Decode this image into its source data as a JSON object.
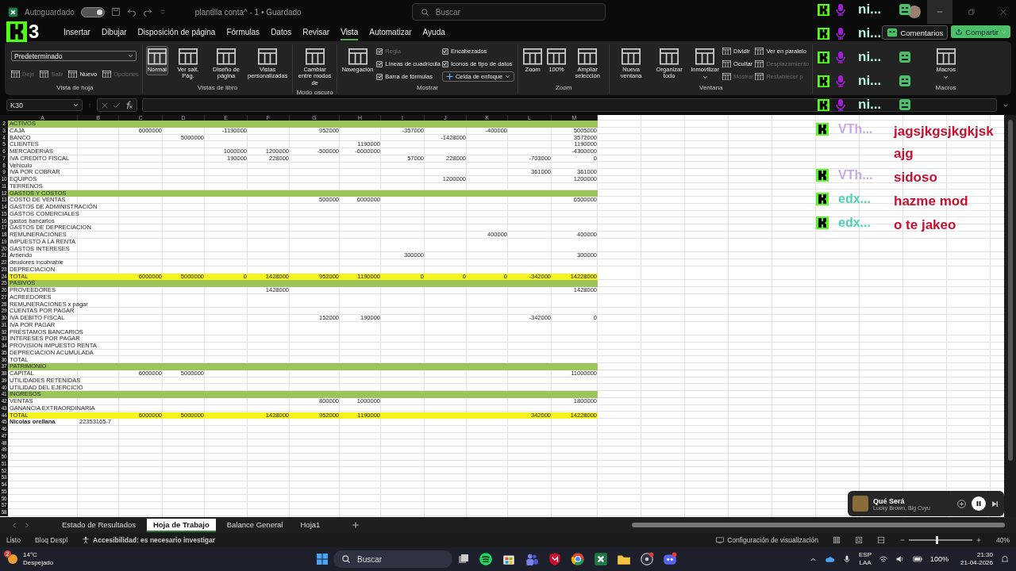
{
  "titlebar": {
    "autosave_label": "Autoguardado",
    "autosave_on": true,
    "title": "plantilla conta^ - 1 • Guardado",
    "search_placeholder": "Buscar"
  },
  "stream_badge": "3",
  "menu": [
    {
      "label": "Insertar",
      "selected": false
    },
    {
      "label": "Dibujar",
      "selected": false
    },
    {
      "label": "Disposición de página",
      "selected": false
    },
    {
      "label": "Fórmulas",
      "selected": false
    },
    {
      "label": "Datos",
      "selected": false
    },
    {
      "label": "Revisar",
      "selected": false
    },
    {
      "label": "Vista",
      "selected": true
    },
    {
      "label": "Automatizar",
      "selected": false
    },
    {
      "label": "Ayuda",
      "selected": false
    }
  ],
  "comments_button": "Comentarios",
  "share_button": "Compartir",
  "ribbon": [
    {
      "kind": "stacked",
      "label": "Vista de hoja",
      "items": [
        {
          "kind": "select",
          "label": "Predeterminado"
        },
        {
          "kind": "small",
          "label": "Deje",
          "disabled": true
        },
        {
          "kind": "small",
          "label": "Salir",
          "disabled": true
        },
        {
          "kind": "small",
          "label": "Nuevo",
          "disabled": false
        },
        {
          "kind": "small",
          "label": "Opciones",
          "disabled": true
        }
      ]
    },
    {
      "kind": "columns",
      "label": "Vistas de libro",
      "columns": [
        [
          {
            "kind": "large",
            "label": "Normal",
            "selected": true
          }
        ],
        [
          {
            "kind": "large",
            "label": "Ver salt. Pág.",
            "selected": false
          }
        ],
        [
          {
            "kind": "large",
            "label": "Diseño de página",
            "selected": false
          }
        ],
        [
          {
            "kind": "large",
            "label": "Vistas personalizadas",
            "selected": false
          }
        ]
      ]
    },
    {
      "kind": "columns",
      "label": "Modo oscuro",
      "columns": [
        [
          {
            "kind": "large",
            "label": "Cambiar entre modos de"
          }
        ]
      ]
    },
    {
      "kind": "columns",
      "label": "Mostrar",
      "columns": [
        [
          {
            "kind": "large",
            "label": "Navegación"
          }
        ],
        [
          {
            "kind": "check",
            "label": "Regla",
            "checked": true,
            "disabled": true
          },
          {
            "kind": "check",
            "label": "Líneas de cuadrícula",
            "checked": true,
            "disabled": false
          },
          {
            "kind": "check",
            "label": "Barra de fórmulas",
            "checked": true,
            "disabled": false
          }
        ],
        [
          {
            "kind": "check",
            "label": "Encabezados",
            "checked": true,
            "disabled": false
          },
          {
            "kind": "check",
            "label": "Iconos de tipo de datos",
            "checked": true,
            "disabled": false
          },
          {
            "kind": "dropdown",
            "label": "Celda de enfoque"
          }
        ]
      ]
    },
    {
      "kind": "columns",
      "label": "Zoom",
      "columns": [
        [
          {
            "kind": "large",
            "label": "Zoom"
          }
        ],
        [
          {
            "kind": "large",
            "label": "100%"
          }
        ],
        [
          {
            "kind": "large",
            "label": "Ampliar selección"
          }
        ]
      ]
    },
    {
      "kind": "columns",
      "label": "Ventana",
      "columns": [
        [
          {
            "kind": "large",
            "label": "Nueva ventana"
          }
        ],
        [
          {
            "kind": "large",
            "label": "Organizar todo"
          }
        ],
        [
          {
            "kind": "large",
            "label": "Inmovilizar",
            "menu": true
          }
        ],
        [
          {
            "kind": "small",
            "label": "Dividir",
            "disabled": false
          },
          {
            "kind": "small",
            "label": "Ocultar",
            "disabled": false
          },
          {
            "kind": "small",
            "label": "Mostrar",
            "disabled": true
          }
        ],
        [
          {
            "kind": "small",
            "label": "Ver en paralelo",
            "disabled": false
          },
          {
            "kind": "small",
            "label": "Desplazamiento",
            "disabled": true
          },
          {
            "kind": "small",
            "label": "Restablecer p",
            "disabled": true
          }
        ]
      ]
    },
    {
      "kind": "columns",
      "label": "Macros",
      "columns": [
        [
          {
            "kind": "large",
            "label": "Macros",
            "menu": true
          }
        ]
      ]
    }
  ],
  "formula_bar": {
    "name_box": "K30"
  },
  "sheet": {
    "columns": [
      "A",
      "B",
      "C",
      "D",
      "E",
      "F",
      "G",
      "H",
      "I",
      "J",
      "K",
      "L",
      "M"
    ],
    "rows": [
      {
        "num": "2",
        "kind": "section",
        "label": "ACTIVOS"
      },
      {
        "num": "3",
        "kind": "data",
        "label": "CAJA",
        "values": {
          "c": "6000000",
          "e": "-1190000",
          "g": "952000",
          "i": "-357000",
          "k": "-400000",
          "m": "5005000"
        }
      },
      {
        "num": "4",
        "kind": "data",
        "label": "BANCO",
        "values": {
          "d": "5000000",
          "j": "-1428000",
          "m": "3572000"
        }
      },
      {
        "num": "5",
        "kind": "data",
        "label": "CLIENTES",
        "values": {
          "h": "1190000",
          "m": "1190000"
        }
      },
      {
        "num": "6",
        "kind": "data",
        "label": "MERCADERIAS",
        "values": {
          "e": "1000000",
          "f": "1200000",
          "g": "-500000",
          "h": "-6000000",
          "m": "-4300000"
        }
      },
      {
        "num": "7",
        "kind": "data",
        "label": "IVA CREDITO FISCAL",
        "values": {
          "e": "190000",
          "f": "228000",
          "i": "57000",
          "j": "228000",
          "l": "-703000",
          "m": "0"
        }
      },
      {
        "num": "8",
        "kind": "data",
        "label": "Vehiculo",
        "values": {}
      },
      {
        "num": "9",
        "kind": "data",
        "label": "IVA POR COBRAR",
        "values": {
          "l": "361000",
          "m": "361000"
        }
      },
      {
        "num": "10",
        "kind": "data",
        "label": "EQUIPOS",
        "values": {
          "j": "1200000",
          "m": "1200000"
        }
      },
      {
        "num": "11",
        "kind": "data",
        "label": "TERRENOS",
        "values": {}
      },
      {
        "num": "12",
        "kind": "section",
        "label": "GASTOS Y COSTOS"
      },
      {
        "num": "13",
        "kind": "data",
        "label": "COSTO DE VENTAS",
        "values": {
          "g": "500000",
          "h": "6000000",
          "m": "6500000"
        }
      },
      {
        "num": "14",
        "kind": "data",
        "label": "GASTOS DE ADMINISTRACIÓN",
        "values": {}
      },
      {
        "num": "15",
        "kind": "data",
        "label": "GASTOS COMERCIALES",
        "values": {}
      },
      {
        "num": "16",
        "kind": "data",
        "label": "gastos bancarios",
        "values": {}
      },
      {
        "num": "17",
        "kind": "data",
        "label": " GASTOS DE DEPRECIACION",
        "values": {}
      },
      {
        "num": "18",
        "kind": "data",
        "label": "REMUNERACIONES",
        "values": {
          "k": "400000",
          "m": "400000"
        }
      },
      {
        "num": "19",
        "kind": "data",
        "label": "IMPUESTO A LA RENTA",
        "values": {}
      },
      {
        "num": "20",
        "kind": "data",
        "label": "GASTOS INTERESES",
        "values": {}
      },
      {
        "num": "21",
        "kind": "data",
        "label": "Arriendo",
        "values": {
          "i": "300000",
          "m": "300000"
        }
      },
      {
        "num": "22",
        "kind": "data",
        "label": "deudores incobrable",
        "values": {}
      },
      {
        "num": "23",
        "kind": "data",
        "label": "DEPRECIACION",
        "values": {}
      },
      {
        "num": "24",
        "kind": "total",
        "label": "TOTAL",
        "values": {
          "c": "6000000",
          "d": "5000000",
          "e": "0",
          "f": "1428000",
          "g": "952000",
          "h": "1190000",
          "i": "0",
          "j": "0",
          "k": "0",
          "l": "-342000",
          "m": "14228000"
        }
      },
      {
        "num": "25",
        "kind": "section",
        "label": "PASIVOS"
      },
      {
        "num": "26",
        "kind": "data",
        "label": "PROVEEDORES",
        "values": {
          "f": "1428000",
          "m": "1428000"
        }
      },
      {
        "num": "27",
        "kind": "data",
        "label": "ACREEDORES",
        "values": {}
      },
      {
        "num": "28",
        "kind": "data",
        "label": "REMUNERACIONES x pagar",
        "values": {}
      },
      {
        "num": "29",
        "kind": "data",
        "label": "CUENTAS POR PAGAR",
        "values": {}
      },
      {
        "num": "30",
        "kind": "data",
        "label": "IVA DEBITO FISCAL",
        "values": {
          "g": "152000",
          "h": "190000",
          "l": "-342000",
          "m": "0"
        }
      },
      {
        "num": "31",
        "kind": "data",
        "label": "IVA POR PAGAR",
        "values": {}
      },
      {
        "num": "32",
        "kind": "data",
        "label": "PRÉSTAMOS BANCARIOS",
        "values": {}
      },
      {
        "num": "33",
        "kind": "data",
        "label": "INTERESES POR PAGAR",
        "values": {}
      },
      {
        "num": "34",
        "kind": "data",
        "label": "PROVISION IMPUESTO RENTA",
        "values": {}
      },
      {
        "num": "35",
        "kind": "data",
        "label": "DEPRECIACION ACUMULADA",
        "values": {}
      },
      {
        "num": "36",
        "kind": "data",
        "label": "TOTAL",
        "values": {}
      },
      {
        "num": "37",
        "kind": "section",
        "label": "PATRIMONIO"
      },
      {
        "num": "38",
        "kind": "data",
        "label": "CAPITAL",
        "values": {
          "c": "6000000",
          "d": "5000000",
          "m": "11000000"
        }
      },
      {
        "num": "39",
        "kind": "data",
        "label": "UTILIDADES RETENIDAS",
        "values": {}
      },
      {
        "num": "40",
        "kind": "data",
        "label": "UTILIDAD DEL EJERCICIO",
        "values": {}
      },
      {
        "num": "41",
        "kind": "section",
        "label": "INGRESOS"
      },
      {
        "num": "42",
        "kind": "data",
        "label": "VENTAS",
        "values": {
          "g": "800000",
          "h": "1000000",
          "m": "1800000"
        }
      },
      {
        "num": "43",
        "kind": "data",
        "label": "GANANCIA EXTRAORDINARIA",
        "values": {}
      },
      {
        "num": "44",
        "kind": "total",
        "label": "TOTAL",
        "values": {
          "c": "6000000",
          "d": "5000000",
          "f": "1428000",
          "g": "952000",
          "h": "1190000",
          "l": "342000",
          "m": "14228000"
        }
      },
      {
        "num": "45",
        "kind": "name",
        "label": "Nicolas orellana",
        "id_number": "22353165-7"
      }
    ],
    "empty_rows": [
      "46",
      "47",
      "48",
      "49",
      "50",
      "51",
      "52",
      "53",
      "54",
      "55",
      "56",
      "57",
      "58"
    ]
  },
  "sheet_tabs": [
    {
      "label": "Estado de Resultados",
      "selected": false
    },
    {
      "label": "Hoja de Trabajo",
      "selected": true
    },
    {
      "label": "Balance General",
      "selected": false
    },
    {
      "label": "Hoja1",
      "selected": false
    }
  ],
  "status_bar": {
    "ready": "Listo",
    "scroll_lock": "Bloq Despl",
    "accessibility": "Accesibilidad: es necesario investigar",
    "display_settings": "Configuración de visualización",
    "zoom_slider": {
      "level": 0.45
    },
    "zoom": "40%"
  },
  "taskbar": {
    "weather_badge": "2",
    "temperature": "14°C",
    "weather": "Despejado",
    "search_placeholder": "Buscar",
    "language": "ESP",
    "region": "LAA",
    "battery": "100%",
    "time": "21:30",
    "date": "21-04-2026"
  },
  "overlay": {
    "voice": [
      {
        "name": "ni...",
        "emote": true
      },
      {
        "name": "ni...",
        "emote": false
      },
      {
        "name": "ni...",
        "emote": true
      },
      {
        "name": "ni...",
        "emote": true
      },
      {
        "name": "ni...",
        "emote": true
      }
    ],
    "chat": [
      {
        "user": "VTh...",
        "color": "#c9a8e8",
        "message": "jagsjkgsjkgkjsk ajg"
      },
      {
        "user": "VTh...",
        "color": "#c9a8e8",
        "message": "sidoso"
      },
      {
        "user": "edx...",
        "color": "#4fd1b5",
        "message": "hazme mod"
      },
      {
        "user": "edx...",
        "color": "#4fd1b5",
        "message": "o te jakeo"
      }
    ]
  },
  "now_playing": {
    "title": "Qué Será",
    "artist": "Lucky Brown, Big Cvyu",
    "playing": true
  }
}
